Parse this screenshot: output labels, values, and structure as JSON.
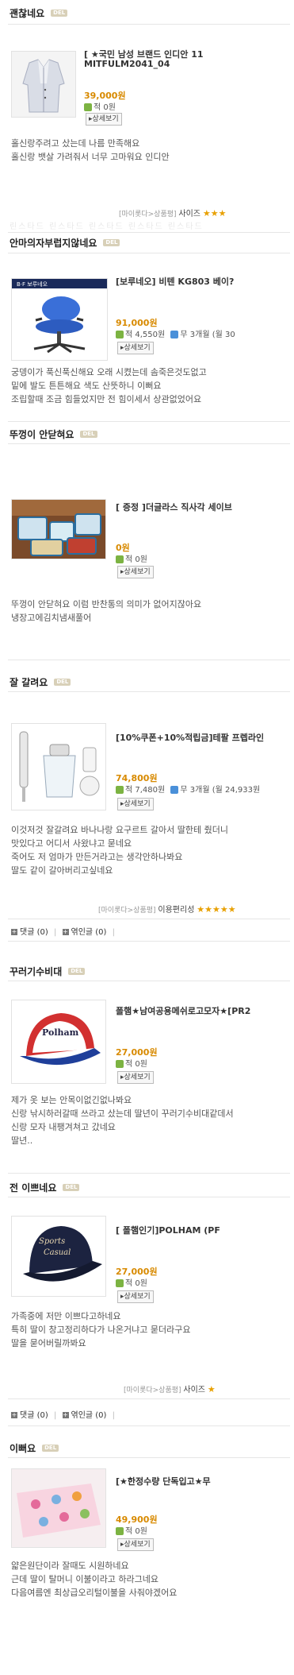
{
  "posts": [
    {
      "title": "괜찮네요",
      "del": "DEL",
      "product": "[ ★국민 남성 브랜드 인디안 11 MITFULM2041_04",
      "product_line1": "[ ★국민 남성 브랜드 인디안 11",
      "product_line2": "MITFULM2041_04",
      "price": "39,000원",
      "points": "적 0원",
      "detail_btn": "상세보기",
      "body": [
        "홀신랑주려고 샀는데 나름 만족해요",
        "홀신랑 뱃살 가려줘서 너무 고마워요 인디안"
      ],
      "crumb": "[마이롯다>상품평]",
      "crumb_item": "사이즈",
      "stars": "★★★"
    },
    {
      "title": "안마의자부럽지않네요",
      "del": "DEL",
      "product": "[보루네오] 비텐 KG803 베이?",
      "brand_tag": "B·F 보루네오",
      "price": "91,000원",
      "points": "적 4,550원",
      "installment": "무 3개월 (월 30",
      "detail_btn": "상세보기",
      "body": [
        "궁뎅이가 푹신푹신해요 오래 시켰는데 솜죽은것도없고",
        "밑에 발도 튼튼해요 색도 산뜻하니 이뻐요",
        "조립할때 조금 힘들었지만 전 힘이세서 상관없었어요"
      ]
    },
    {
      "title": "뚜껑이 안닫혀요",
      "del": "DEL",
      "product": "[ 증정 ]더글라스 직사각 세이브",
      "price": "0원",
      "points": "적 0원",
      "detail_btn": "상세보기",
      "body": [
        "뚜껑이 안닫혀요 이럼 반찬통의 의미가 없어지잖아요",
        "냉장고에김치냄새풀어"
      ]
    },
    {
      "title": "잘 갈려요",
      "del": "DEL",
      "product": "[10%쿠폰+10%적립금]테팔 프렙라인",
      "price": "74,800원",
      "points": "적 7,480원",
      "installment": "무 3개월 (월 24,933원",
      "detail_btn": "상세보기",
      "body": [
        "이것저것 잘갈려요 바나나랑 요구르트 갈아서 딸한테 줬더니",
        "맛있다고 어디서 사왔냐고 묻네요",
        "죽어도 저 엄마가 만든거라고는 생각안하나봐요",
        "딸도 같이 갈아버리고싶네요"
      ],
      "crumb": "[마이롯다>상품평]",
      "crumb_item": "이용편리성",
      "stars": "★★★★★",
      "comments": "댓글 (0)",
      "trackbacks": "엮인글 (0)"
    },
    {
      "title": "꾸러기수비대",
      "del": "DEL",
      "product": "폴햄★남여공용메쉬로고모자★[PR2",
      "price": "27,000원",
      "points": "적 0원",
      "detail_btn": "상세보기",
      "body": [
        "제가 옷 보는 안목이없긴없나봐요",
        "신랑 낚시하러갈때 쓰라고 샀는데 딸년이 꾸러기수비대같데서",
        "신랑 모자 내팽겨쳐고 갔네요",
        "딸년.."
      ]
    },
    {
      "title": "전 이쁘네요",
      "del": "DEL",
      "product": "[ 폴햄인기]POLHAM (PF",
      "price": "27,000원",
      "points": "적 0원",
      "detail_btn": "상세보기",
      "body": [
        "가족중에 저만 이쁘다고하네요",
        "특히 딸이 창고정리하다가 나온거냐고 묻더라구요",
        "딸을 묻어버릴까봐요"
      ],
      "crumb": "[마이롯다>상품평]",
      "crumb_item": "사이즈",
      "stars": "★",
      "comments": "댓글 (0)",
      "trackbacks": "엮인글 (0)"
    },
    {
      "title": "이뻐요",
      "del": "DEL",
      "product": "[★한정수량 단독입고★무",
      "price": "49,900원",
      "points": "적 0원",
      "detail_btn": "상세보기",
      "body": [
        "얇은원단이라 잘때도 시원하네요",
        "근데 딸이 탈머니 이불이라고 하라그네요",
        "다음여름엔 최상급오리털이불을 사줘야겠어요"
      ]
    }
  ],
  "watermark": "린스타드  린스타드  린스타드  린스타드  린스타드",
  "colors": {
    "price": "#d88a00",
    "star": "#e8a000",
    "badge": "#d8d0b8",
    "points_icon": "#7cb342",
    "installment_icon": "#4a90d9"
  },
  "icons": [
    "points-icon",
    "installment-icon",
    "plus-icon"
  ]
}
